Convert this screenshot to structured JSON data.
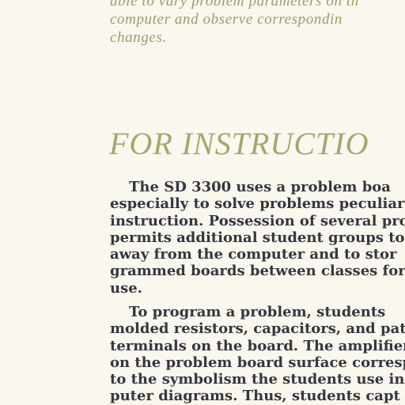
{
  "intro": {
    "lines": [
      "able to vary problem parameters on th",
      "computer and observe correspondin",
      "changes."
    ]
  },
  "heading": "FOR INSTRUCTIO",
  "paragraphs": [
    {
      "lines": [
        "The SD 3300 uses a problem boa",
        "especially to solve problems peculiar",
        "instruction. Possession of several pro",
        "permits additional student groups to s",
        "away from the computer and to stor",
        "grammed boards between classes for",
        "use."
      ]
    },
    {
      "lines": [
        "To program a problem, students",
        "molded resistors, capacitors, and patc",
        "terminals on the board. The amplifier",
        "on the problem board surface correspo",
        "to the symbolism the students use in d",
        "puter diagrams. Thus, students capt"
      ]
    }
  ]
}
